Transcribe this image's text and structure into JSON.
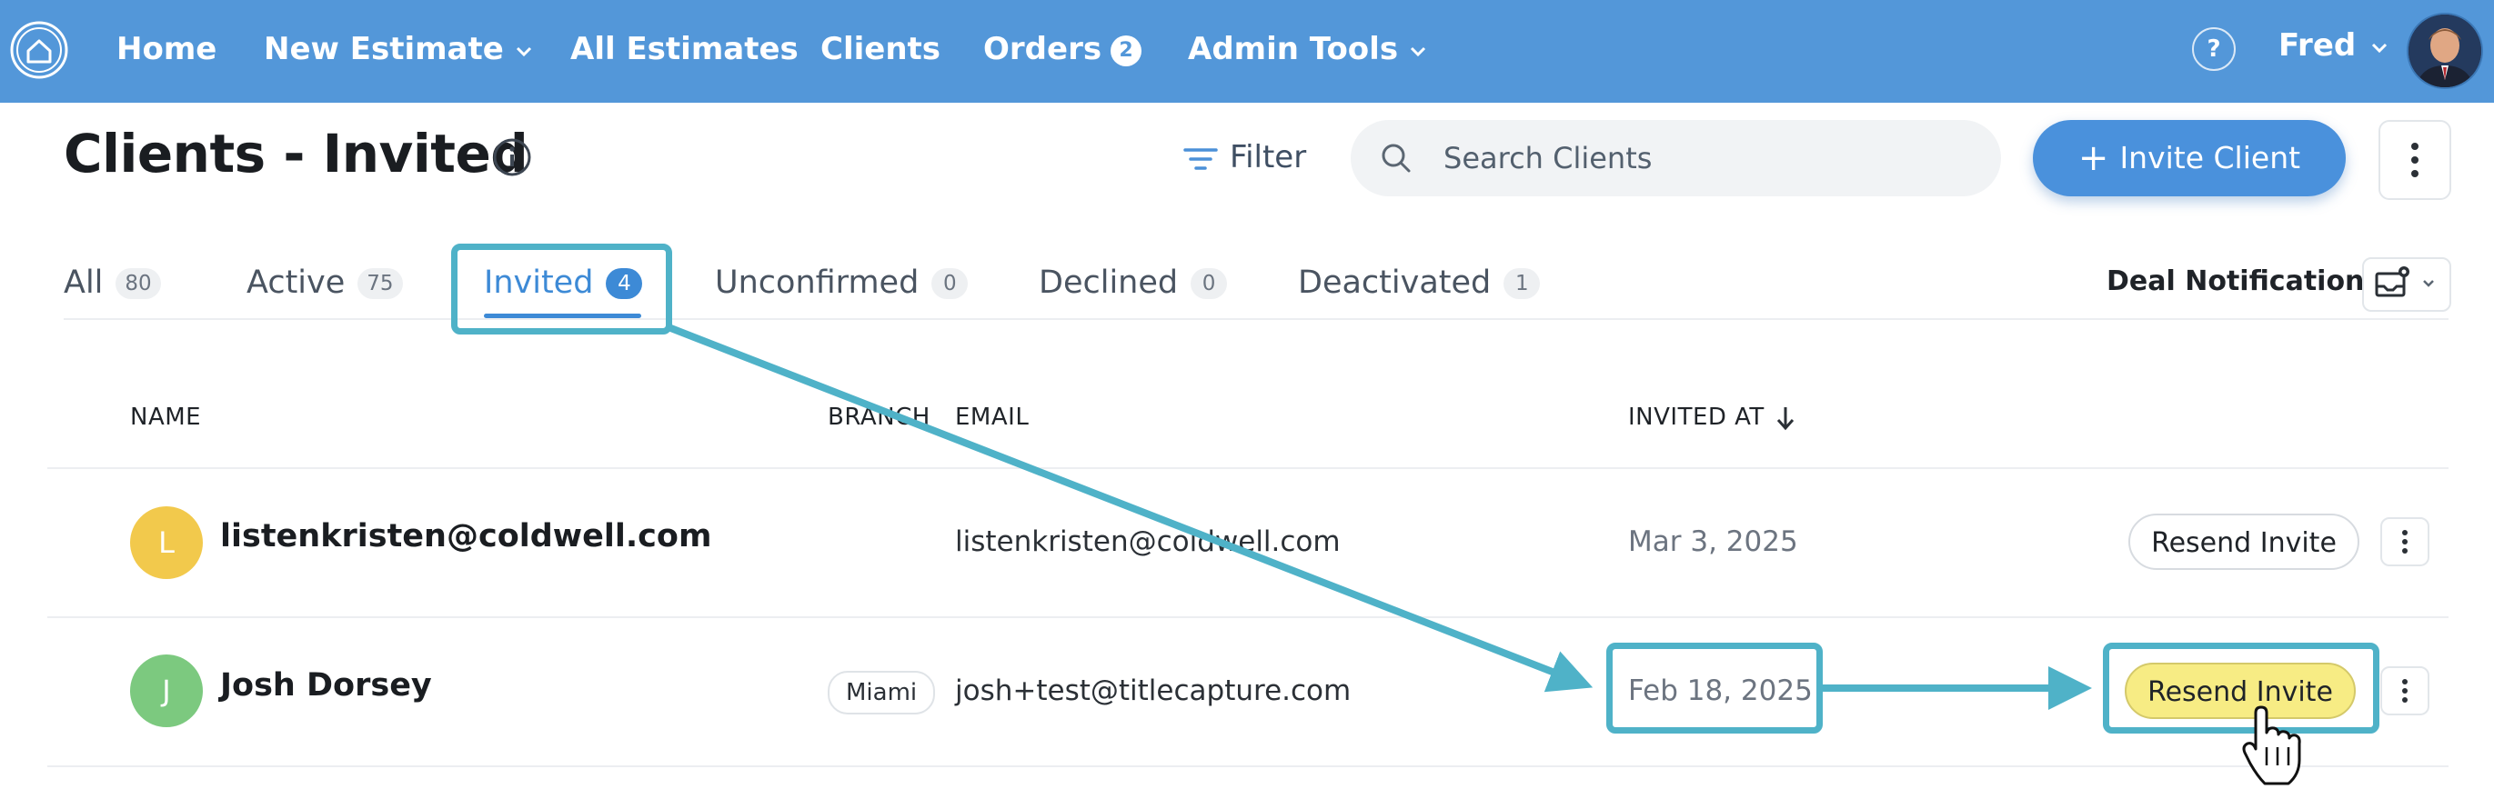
{
  "nav": {
    "items": [
      {
        "label": "Home"
      },
      {
        "label": "New Estimate"
      },
      {
        "label": "All Estimates"
      },
      {
        "label": "Clients"
      },
      {
        "label": "Orders",
        "badge": "2"
      },
      {
        "label": "Admin Tools"
      }
    ],
    "help": "?",
    "user": "Fred",
    "brand_color": "#5397d9"
  },
  "header": {
    "title": "Clients - Invited",
    "filter_label": "Filter",
    "search_placeholder": "Search Clients",
    "invite_button": "Invite Client"
  },
  "tabs": [
    {
      "label": "All",
      "count": "80"
    },
    {
      "label": "Active",
      "count": "75"
    },
    {
      "label": "Invited",
      "count": "4"
    },
    {
      "label": "Unconfirmed",
      "count": "0"
    },
    {
      "label": "Declined",
      "count": "0"
    },
    {
      "label": "Deactivated",
      "count": "1"
    }
  ],
  "deal_notifications_label": "Deal Notifications",
  "table": {
    "columns": {
      "name": "NAME",
      "branch": "BRANCH",
      "email": "EMAIL",
      "invited_at": "INVITED AT"
    },
    "rows": [
      {
        "initial": "L",
        "name": "listenkristen@coldwell.com",
        "branch": "",
        "email": "listenkristen@coldwell.com",
        "invited_at": "Mar 3, 2025",
        "action": "Resend Invite",
        "avatar_color": "#f2c94c"
      },
      {
        "initial": "J",
        "name": "Josh Dorsey",
        "branch": "Miami",
        "email": "josh+test@titlecapture.com",
        "invited_at": "Feb 18, 2025",
        "action": "Resend Invite",
        "avatar_color": "#7cc97f"
      }
    ]
  },
  "annotation_color": "#4fb2c8"
}
